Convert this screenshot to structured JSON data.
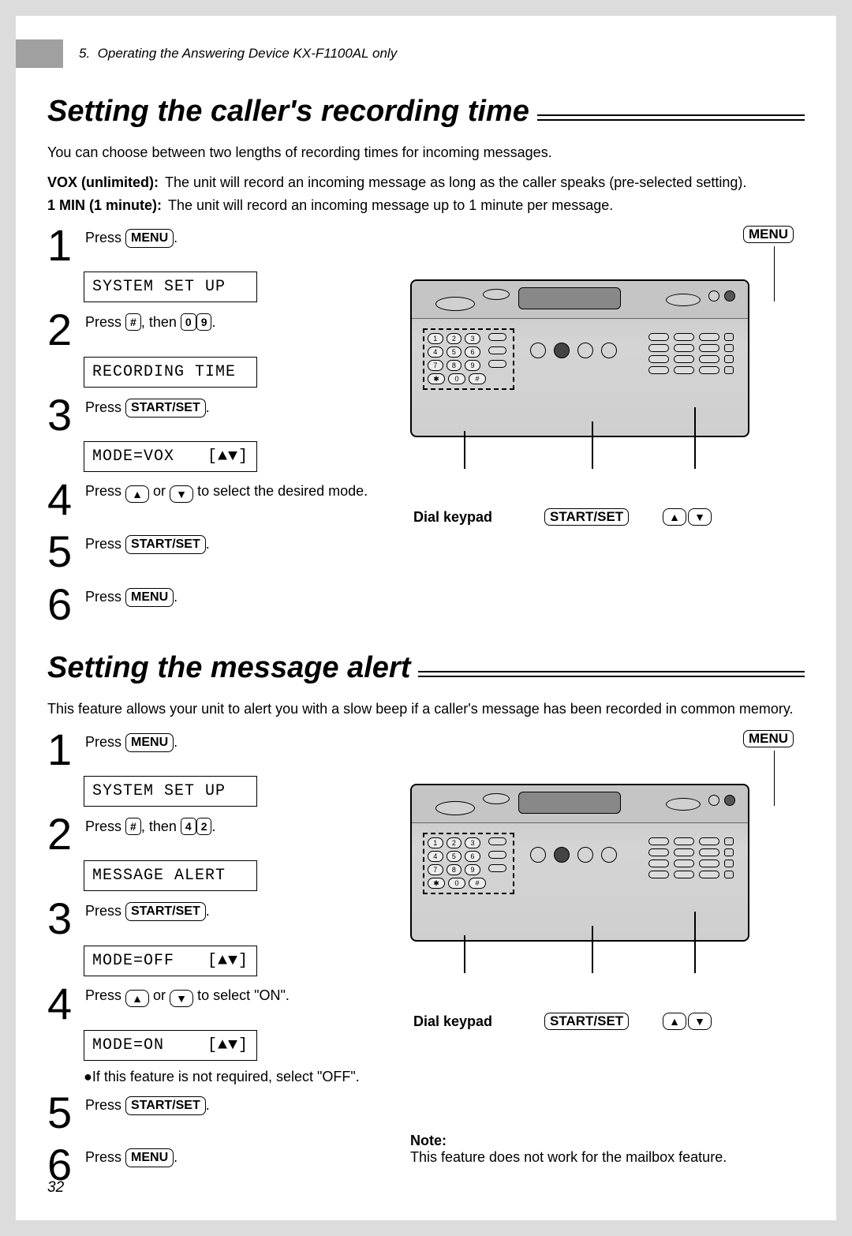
{
  "header": {
    "chapter": "5.",
    "title": "Operating the Answering Device KX-F1100AL only"
  },
  "section1": {
    "title": "Setting the caller's recording time",
    "intro": "You can choose between two lengths of recording times for incoming messages.",
    "def_vox_label": "VOX (unlimited):",
    "def_vox_text": "The unit will record an incoming message as long as the caller speaks (pre-selected setting).",
    "def_min_label": "1 MIN (1 minute):",
    "def_min_text": "The unit will record an incoming message up to 1 minute per message.",
    "steps": {
      "s1": {
        "n": "1",
        "press": "Press",
        "key": "MENU"
      },
      "lcd1": "SYSTEM SET UP",
      "s2": {
        "n": "2",
        "press": "Press",
        "key": "#",
        "then": ", then",
        "d1": "0",
        "d2": "9"
      },
      "lcd2": "RECORDING TIME",
      "s3": {
        "n": "3",
        "press": "Press",
        "key": "START/SET"
      },
      "lcd3_left": "MODE=VOX",
      "lcd3_right": "[▲▼]",
      "s4": {
        "n": "4",
        "press": "Press",
        "sel": "to select the desired mode."
      },
      "s5": {
        "n": "5",
        "press": "Press",
        "key": "START/SET"
      },
      "s6": {
        "n": "6",
        "press": "Press",
        "key": "MENU"
      }
    }
  },
  "section2": {
    "title": "Setting the message alert",
    "intro": "This feature allows your unit to alert you with a slow beep if a caller's message has been recorded in common memory.",
    "steps": {
      "s1": {
        "n": "1",
        "press": "Press",
        "key": "MENU"
      },
      "lcd1": "SYSTEM SET UP",
      "s2": {
        "n": "2",
        "press": "Press",
        "key": "#",
        "then": ", then",
        "d1": "4",
        "d2": "2"
      },
      "lcd2": "MESSAGE ALERT",
      "s3": {
        "n": "3",
        "press": "Press",
        "key": "START/SET"
      },
      "lcd3_left": "MODE=OFF",
      "lcd3_right": "[▲▼]",
      "s4": {
        "n": "4",
        "press": "Press",
        "sel": "to select \"ON\"."
      },
      "lcd4_left": "MODE=ON",
      "lcd4_right": "[▲▼]",
      "bullet": "●If this feature is not required, select \"OFF\".",
      "s5": {
        "n": "5",
        "press": "Press",
        "key": "START/SET"
      },
      "s6": {
        "n": "6",
        "press": "Press",
        "key": "MENU"
      }
    },
    "note_label": "Note:",
    "note_text": "This feature does not work for the mailbox feature."
  },
  "device_labels": {
    "menu": "MENU",
    "dial_keypad": "Dial keypad",
    "start_set": "START/SET",
    "up": "▲",
    "down": "▼"
  },
  "keypad_digits": [
    "1",
    "2",
    "3",
    "4",
    "5",
    "6",
    "7",
    "8",
    "9",
    "✱",
    "0",
    "#"
  ],
  "page_num": "32",
  "arrows": {
    "up": "▲",
    "down": "▼",
    "or": " or "
  }
}
